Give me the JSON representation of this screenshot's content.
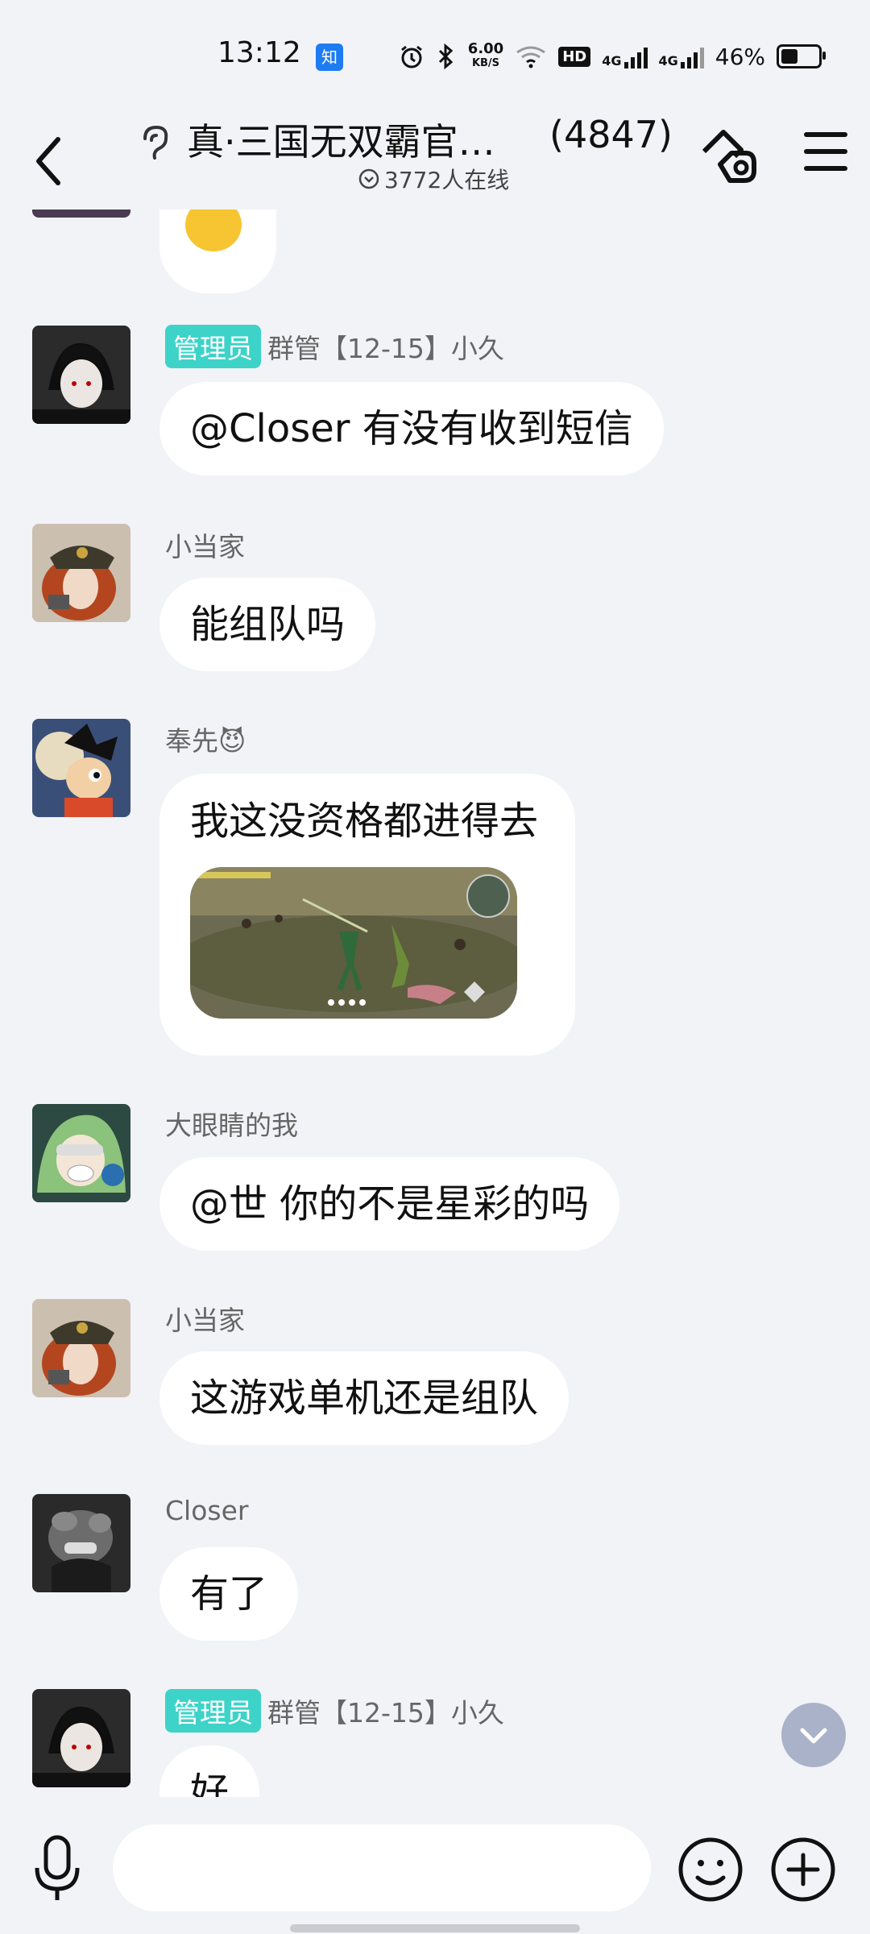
{
  "status": {
    "time": "13:12",
    "app_badge": "知",
    "speed_value": "6.00",
    "speed_unit": "KB/S",
    "hd": "HD",
    "net1": "4G",
    "net2": "4G",
    "battery": "46%"
  },
  "header": {
    "title": "真·三国无双霸官…",
    "member_count": "(4847)",
    "online_text": "3772人在线"
  },
  "messages": [
    {
      "sender": "群管【12-15】小久",
      "role": "管理员",
      "text": "@Closer 有没有收到短信"
    },
    {
      "sender": "小当家",
      "text": "能组队吗"
    },
    {
      "sender": "奉先😈",
      "text": "我这没资格都进得去",
      "has_image": true
    },
    {
      "sender": "大眼睛的我",
      "text": "@世 你的不是星彩的吗"
    },
    {
      "sender": "小当家",
      "text": "这游戏单机还是组队"
    },
    {
      "sender": "Closer",
      "text": "有了"
    },
    {
      "sender": "群管【12-15】小久",
      "role": "管理员",
      "text": "好"
    }
  ],
  "icons": {
    "back": "back-arrow-icon",
    "ear": "earpiece-icon",
    "online": "chevron-circle-icon",
    "header_action": "tag-icon",
    "menu": "menu-icon",
    "scroll_down": "chevron-down-icon",
    "mic": "microphone-icon",
    "emoji": "smiley-icon",
    "plus": "plus-circle-icon"
  },
  "colors": {
    "background": "#f2f3f7",
    "role_badge": "#3dd3c8",
    "bubble": "#ffffff",
    "scroll_button": "#a9b2c8"
  }
}
